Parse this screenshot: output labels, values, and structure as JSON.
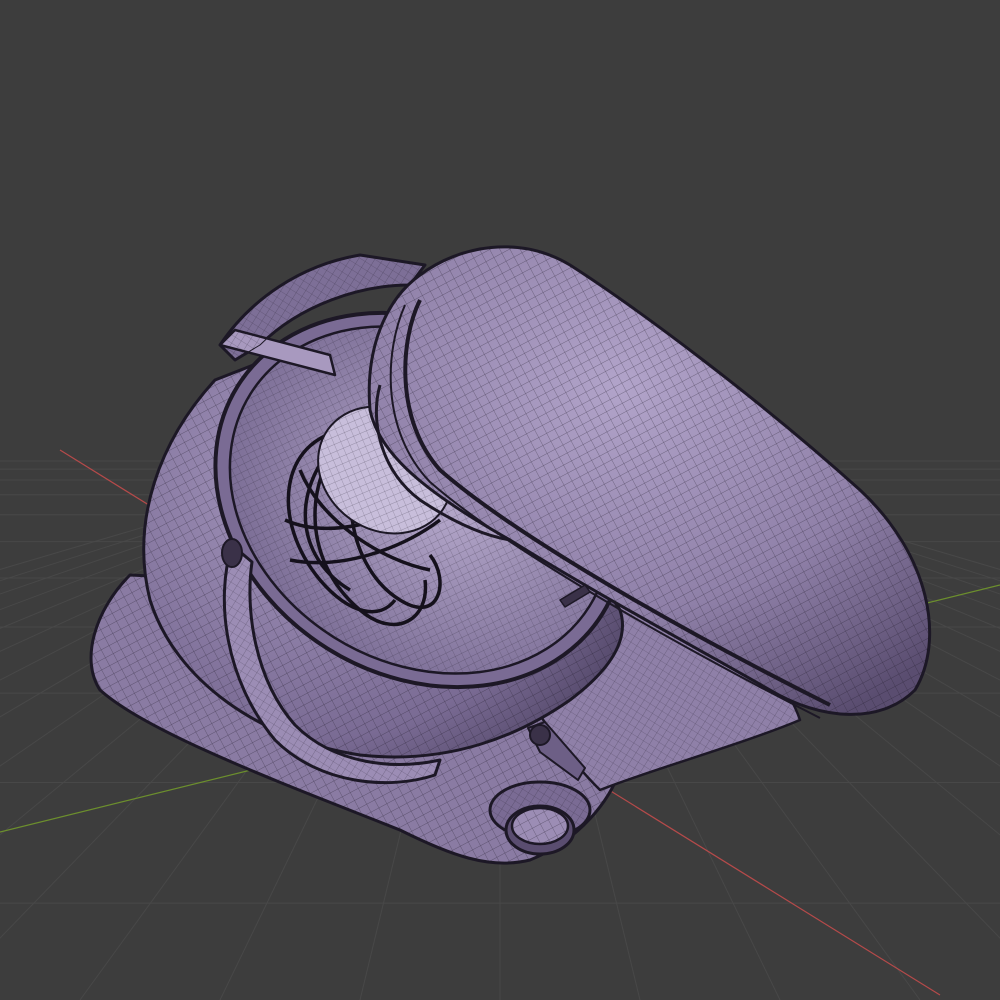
{
  "viewport": {
    "background_color": "#3d3d3d",
    "grid_color": "#484848",
    "axes": {
      "x_axis_color": "#b54a4a",
      "y_axis_color": "#6c8f2d"
    }
  },
  "model": {
    "name": "",
    "display_mode": "wireframe-over-solid",
    "shading": "solid",
    "object_color": "#8f80a8",
    "object_highlight_color": "#b2a4ca",
    "object_shadow_color": "#4b4060",
    "wire_color": "#1d1826",
    "parts": [
      {
        "id": "base",
        "icon": "mixer-base"
      },
      {
        "id": "bowl",
        "icon": "mixer-bowl"
      },
      {
        "id": "bowl_handle",
        "icon": "bowl-handle"
      },
      {
        "id": "whisk",
        "icon": "balloon-whisk"
      },
      {
        "id": "pouring_shield",
        "icon": "pouring-shield"
      },
      {
        "id": "head",
        "icon": "tilt-head"
      },
      {
        "id": "speed_knob",
        "icon": "speed-knob"
      },
      {
        "id": "lock_lever",
        "icon": "lock-lever"
      }
    ]
  }
}
